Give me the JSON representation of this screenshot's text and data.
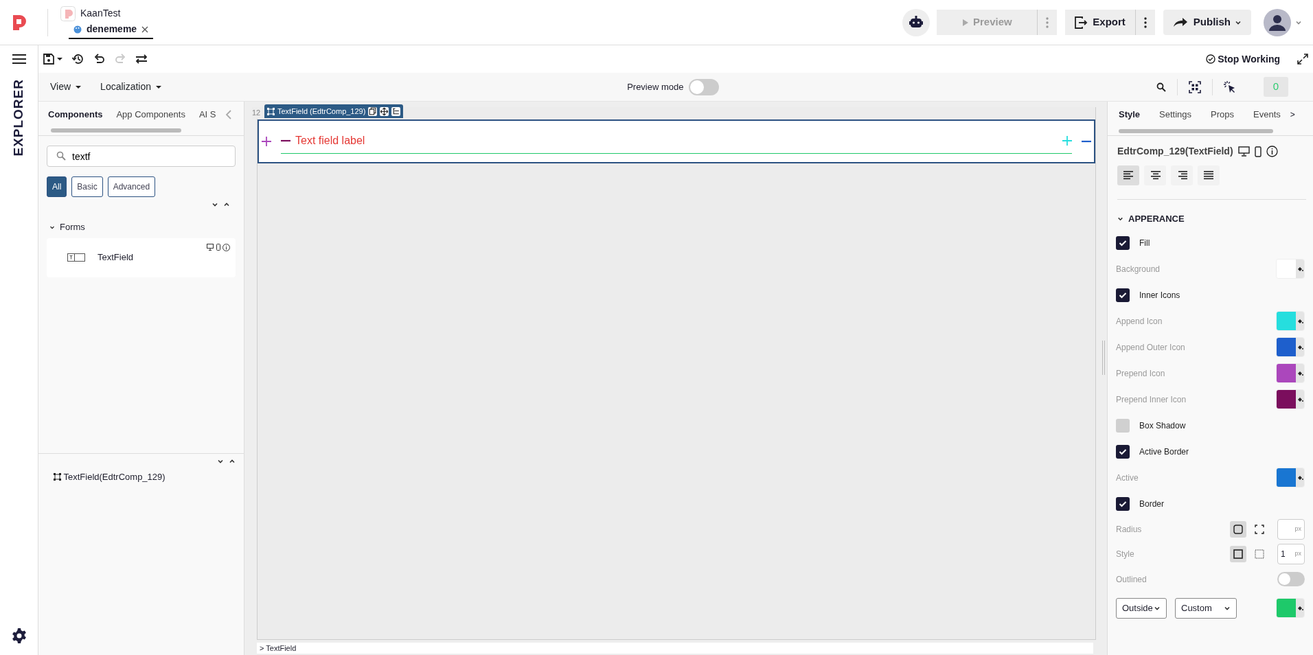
{
  "header": {
    "project_name": "KaanTest",
    "open_tab": {
      "label": "denememe",
      "selected": true
    },
    "preview": {
      "label": "Preview",
      "disabled": true
    },
    "export": {
      "label": "Export"
    },
    "publish": {
      "label": "Publish"
    }
  },
  "toolbar": {
    "redo": {
      "disabled": true
    },
    "stop_working": "Stop Working"
  },
  "ribbon": {
    "menus": [
      "View",
      "Localization"
    ],
    "preview_mode": {
      "label": "Preview mode",
      "on": false
    },
    "counter": "0"
  },
  "sidebar": {
    "title": "EXPLORER",
    "tabs": [
      {
        "label": "Components",
        "selected": true
      },
      {
        "label": "App Components",
        "selected": false
      },
      {
        "label": "AI S",
        "selected": false
      }
    ],
    "search": {
      "value": "textf"
    },
    "filters": [
      {
        "label": "All",
        "selected": true
      },
      {
        "label": "Basic",
        "selected": false
      },
      {
        "label": "Advanced",
        "selected": false
      }
    ],
    "groups": [
      {
        "label": "Forms",
        "expanded": true,
        "items": [
          {
            "label": "TextField"
          }
        ]
      }
    ],
    "tree": [
      {
        "label": "TextField(EdtrComp_129)"
      }
    ]
  },
  "canvas": {
    "ruler": "12",
    "component_tag": "TextField (EdtrComp_129)",
    "field_label": "Text field label",
    "breadcrumb": "> TextField"
  },
  "properties": {
    "tabs": [
      {
        "label": "Style",
        "selected": true
      },
      {
        "label": "Settings",
        "selected": false
      },
      {
        "label": "Props",
        "selected": false
      },
      {
        "label": "Events",
        "selected": false
      }
    ],
    "more": ">",
    "component": "EdtrComp_129(TextField)",
    "align": [
      {
        "kind": "left",
        "selected": true
      },
      {
        "kind": "center",
        "selected": false
      },
      {
        "kind": "right",
        "selected": false
      },
      {
        "kind": "justify",
        "selected": false
      }
    ],
    "section": {
      "title": "APPERANCE",
      "expanded": true,
      "rows": [
        {
          "kind": "checkbox",
          "label": "Fill",
          "checked": true
        },
        {
          "kind": "color",
          "label": "Background",
          "color": "#ffffff"
        },
        {
          "kind": "checkbox",
          "label": "Inner Icons",
          "checked": true
        },
        {
          "kind": "color",
          "label": "Append Icon",
          "color": "#26dede"
        },
        {
          "kind": "color",
          "label": "Append Outer Icon",
          "color": "#1e5fcc"
        },
        {
          "kind": "color",
          "label": "Prepend Icon",
          "color": "#ab47bc"
        },
        {
          "kind": "color",
          "label": "Prepend Inner Icon",
          "color": "#7b0e5d"
        },
        {
          "kind": "checkbox",
          "label": "Box Shadow",
          "checked": false
        },
        {
          "kind": "checkbox",
          "label": "Active Border",
          "checked": true
        },
        {
          "kind": "color",
          "label": "Active",
          "color": "#1976d2"
        },
        {
          "kind": "checkbox",
          "label": "Border",
          "checked": true
        },
        {
          "kind": "shape",
          "label": "Radius",
          "options": [
            {
              "kind": "rounded",
              "selected": true
            },
            {
              "kind": "corners",
              "selected": false
            }
          ],
          "unit": "px"
        },
        {
          "kind": "shape",
          "label": "Style",
          "options": [
            {
              "kind": "solid",
              "selected": true
            },
            {
              "kind": "dotted",
              "selected": false
            }
          ],
          "value": "1",
          "unit": "px"
        },
        {
          "kind": "toggle",
          "label": "Outlined",
          "on": false
        },
        {
          "kind": "selects",
          "selects": [
            "Outside",
            "Custom"
          ],
          "color": "#1ec96a"
        }
      ]
    }
  }
}
